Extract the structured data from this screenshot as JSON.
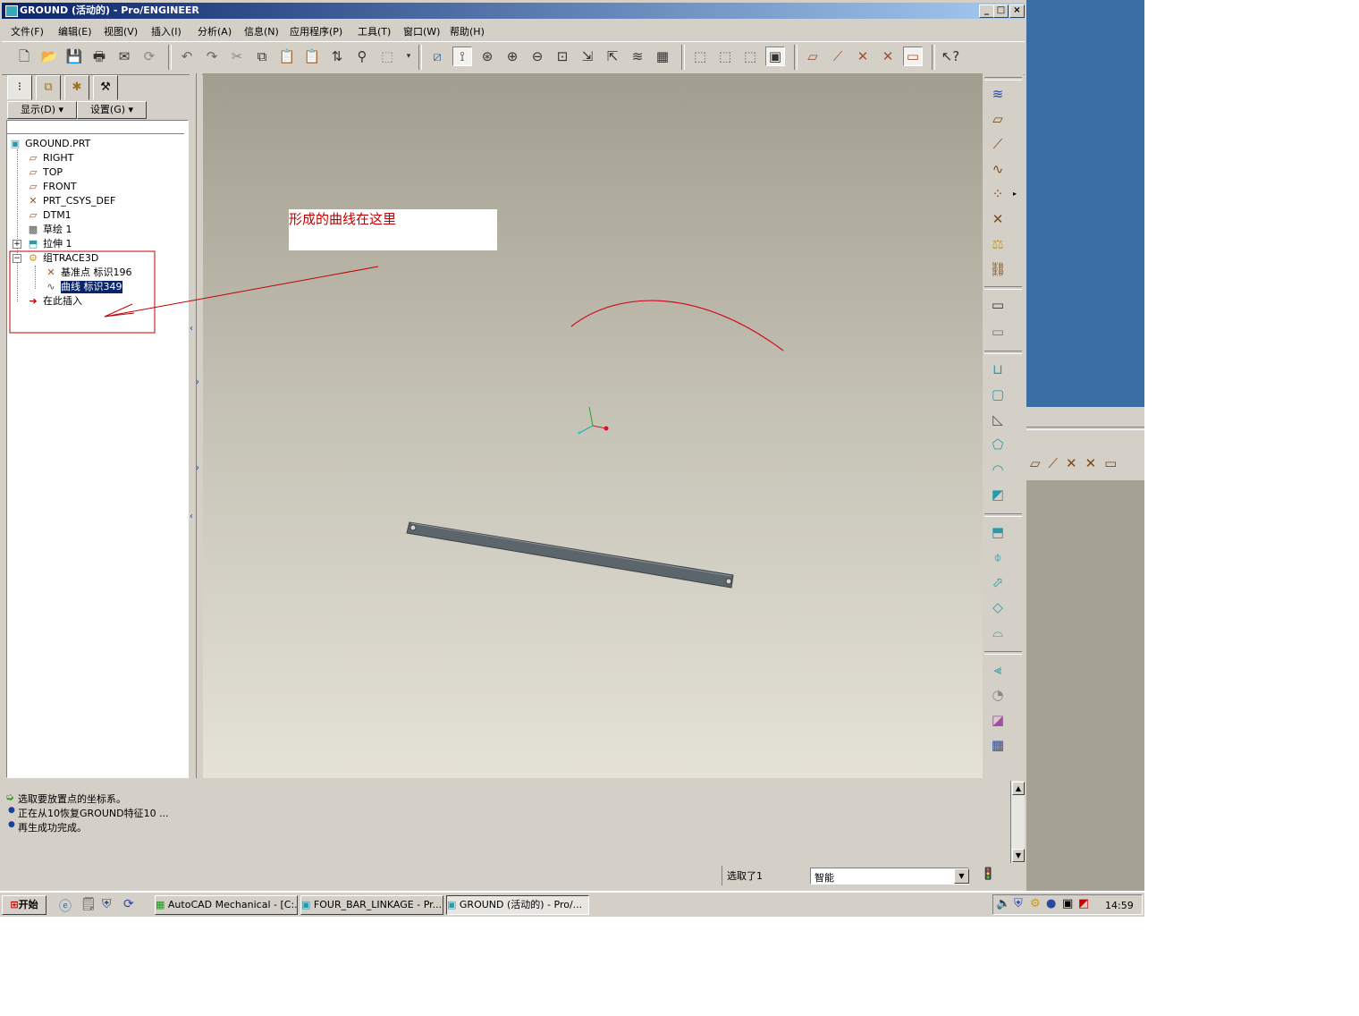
{
  "window": {
    "title": "GROUND (活动的) - Pro/ENGINEER",
    "min_label": "_",
    "max_label": "□",
    "close_label": "×"
  },
  "menus": [
    "文件(F)",
    "编辑(E)",
    "视图(V)",
    "插入(I)",
    "分析(A)",
    "信息(N)",
    "应用程序(P)",
    "工具(T)",
    "窗口(W)",
    "帮助(H)"
  ],
  "left_panel": {
    "show_button": "显示(D) ▾",
    "settings_button": "设置(G) ▾",
    "tree": [
      {
        "label": "GROUND.PRT",
        "icon": "part-icon"
      },
      {
        "label": "RIGHT",
        "icon": "datum-plane-icon"
      },
      {
        "label": "TOP",
        "icon": "datum-plane-icon"
      },
      {
        "label": "FRONT",
        "icon": "datum-plane-icon"
      },
      {
        "label": "PRT_CSYS_DEF",
        "icon": "csys-icon"
      },
      {
        "label": "DTM1",
        "icon": "datum-plane-icon"
      },
      {
        "label": "草绘 1",
        "icon": "sketch-icon"
      },
      {
        "label": "拉伸 1",
        "icon": "extrude-icon",
        "expander": "+"
      },
      {
        "label": "组TRACE3D",
        "icon": "group-icon",
        "expander": "−"
      },
      {
        "label": "基准点 标识196",
        "icon": "datum-point-icon"
      },
      {
        "label": "曲线 标识349",
        "icon": "curve-icon",
        "selected": true
      },
      {
        "label": "在此插入",
        "icon": "insert-here-icon"
      }
    ]
  },
  "annotation": {
    "text": "形成的曲线在这里",
    "color": "#c00000"
  },
  "messages": [
    {
      "icon": "arrow-prompt-icon",
      "text": "选取要放置点的坐标系。"
    },
    {
      "icon": "info-bullet-icon",
      "text": "正在从10恢复GROUND特征10 ..."
    },
    {
      "icon": "info-bullet-icon",
      "text": "再生成功完成。"
    }
  ],
  "status": {
    "selection": "选取了1",
    "filter_value": "智能"
  },
  "taskbar": {
    "start": "开始",
    "tasks": [
      "AutoCAD Mechanical - [C:...",
      "FOUR_BAR_LINKAGE - Pr...",
      "GROUND (活动的) - Pro/..."
    ],
    "clock": "14:59"
  },
  "colors": {
    "titlebar": "#0a246a",
    "curve": "#d01020",
    "link": "#5d656c",
    "desktop": "#3a6ea5"
  }
}
